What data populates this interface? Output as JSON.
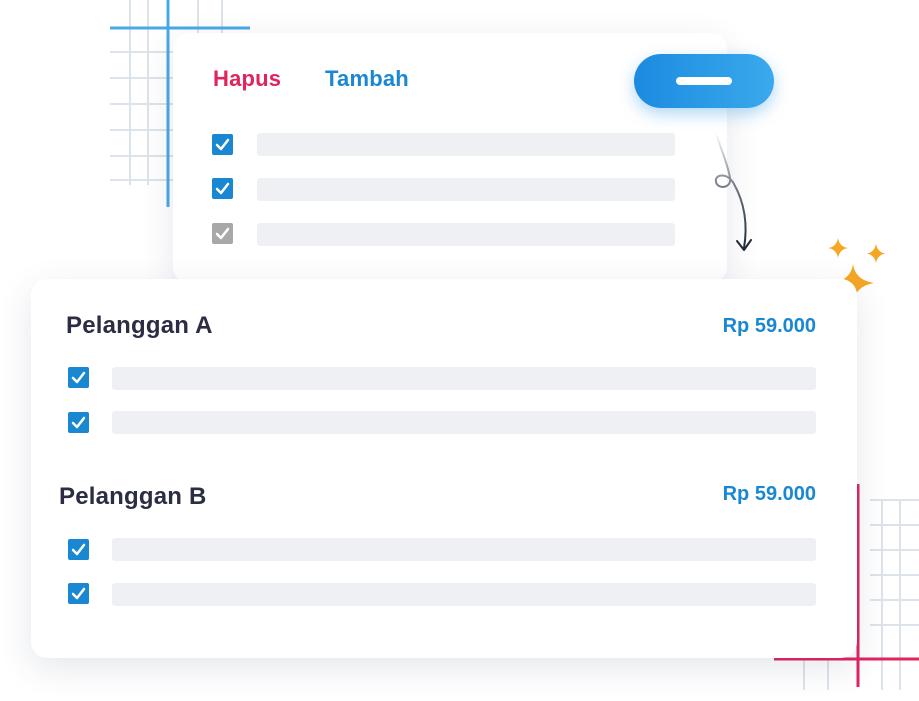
{
  "tabs": {
    "delete_label": "Hapus",
    "add_label": "Tambah"
  },
  "colors": {
    "delete": "#e0245e",
    "accent": "#1a87d3",
    "checkbox_disabled": "#a8a8a8",
    "sparkle": "#f6a623",
    "heading": "#2b2d42"
  },
  "top_list": {
    "items": [
      {
        "checked": true,
        "enabled": true
      },
      {
        "checked": true,
        "enabled": true
      },
      {
        "checked": true,
        "enabled": false
      }
    ]
  },
  "customers": [
    {
      "name": "Pelanggan A",
      "price": "Rp 59.000",
      "items": [
        {
          "checked": true
        },
        {
          "checked": true
        }
      ]
    },
    {
      "name": "Pelanggan B",
      "price": "Rp 59.000",
      "items": [
        {
          "checked": true
        },
        {
          "checked": true
        }
      ]
    }
  ],
  "icons": {
    "action_button": "minus-icon",
    "checkbox": "checkmark-icon",
    "flow_arrow": "curved-arrow-icon",
    "decoration": "sparkle-icon"
  }
}
